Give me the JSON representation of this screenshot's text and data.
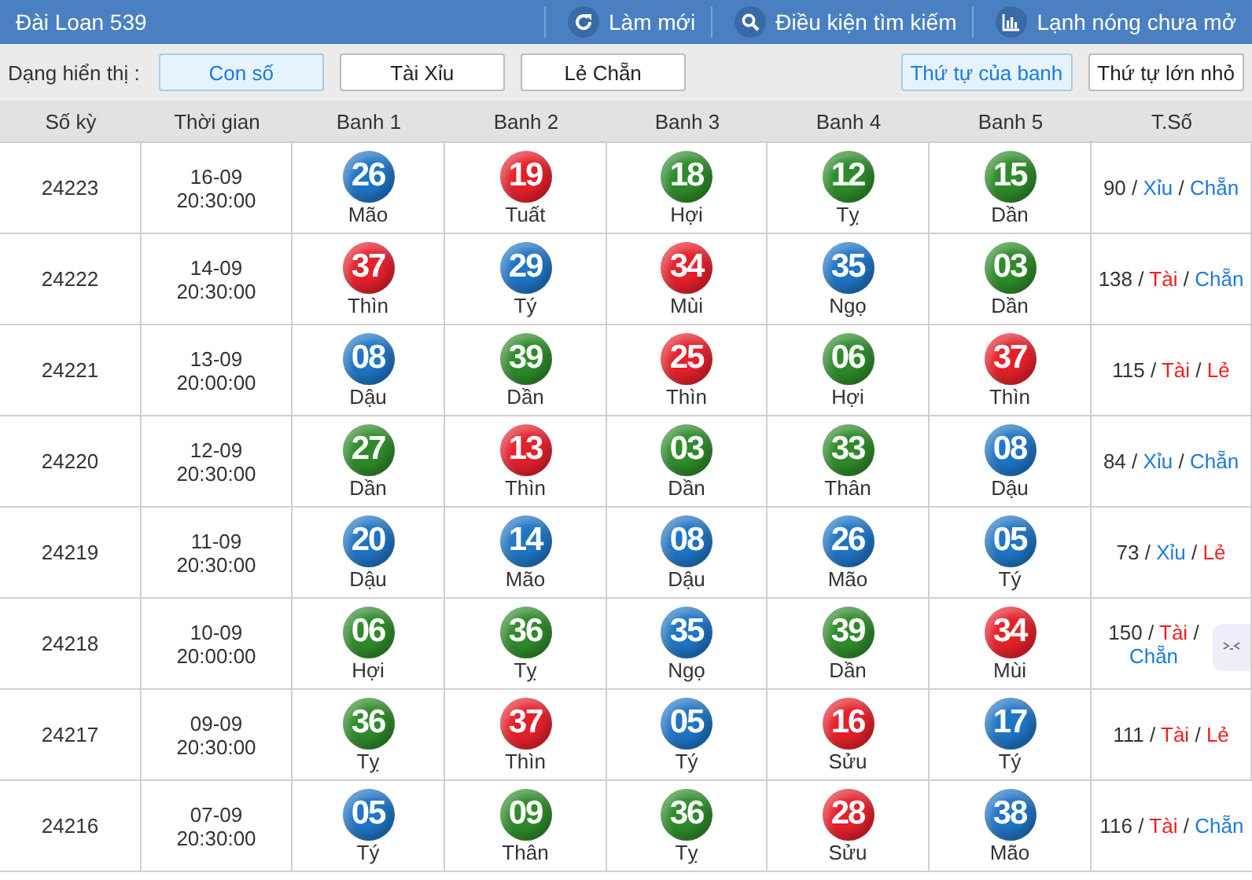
{
  "header": {
    "title": "Đài Loan 539",
    "actions": [
      {
        "label": "Làm mới"
      },
      {
        "label": "Điều kiện tìm kiếm"
      },
      {
        "label": "Lạnh nóng chưa mở"
      }
    ]
  },
  "toolbar": {
    "label": "Dạng hiển thị :",
    "modes": [
      {
        "label": "Con số",
        "selected": true
      },
      {
        "label": "Tài Xỉu",
        "selected": false
      },
      {
        "label": "Lẻ Chẵn",
        "selected": false
      }
    ],
    "orders": [
      {
        "label": "Thứ tự của banh",
        "selected": true
      },
      {
        "label": "Thứ tự lớn nhỏ",
        "selected": false
      }
    ]
  },
  "table": {
    "columns": [
      "Số kỳ",
      "Thời gian",
      "Banh 1",
      "Banh 2",
      "Banh 3",
      "Banh 4",
      "Banh 5",
      "T.Số"
    ],
    "rows": [
      {
        "draw": "24223",
        "date": "16-09",
        "time": "20:30:00",
        "balls": [
          {
            "number": "26",
            "zodiac": "Mão",
            "color": "#1f74c4"
          },
          {
            "number": "19",
            "zodiac": "Tuất",
            "color": "#e5202b"
          },
          {
            "number": "18",
            "zodiac": "Hợi",
            "color": "#2e8a2a"
          },
          {
            "number": "12",
            "zodiac": "Tỵ",
            "color": "#2e8a2a"
          },
          {
            "number": "15",
            "zodiac": "Dần",
            "color": "#2e8a2a"
          }
        ],
        "total": [
          {
            "text": "90"
          },
          {
            "text": "/"
          },
          {
            "text": "Xỉu",
            "color": "#1a7ae0"
          },
          {
            "text": "/"
          },
          {
            "text": "Chẵn",
            "color": "#1a7ae0"
          }
        ]
      },
      {
        "draw": "24222",
        "date": "14-09",
        "time": "20:30:00",
        "balls": [
          {
            "number": "37",
            "zodiac": "Thìn",
            "color": "#e5202b"
          },
          {
            "number": "29",
            "zodiac": "Tý",
            "color": "#1f74c4"
          },
          {
            "number": "34",
            "zodiac": "Mùi",
            "color": "#e5202b"
          },
          {
            "number": "35",
            "zodiac": "Ngọ",
            "color": "#1f74c4"
          },
          {
            "number": "03",
            "zodiac": "Dần",
            "color": "#2e8a2a"
          }
        ],
        "total": [
          {
            "text": "138"
          },
          {
            "text": "/"
          },
          {
            "text": "Tài",
            "color": "#f01e1e"
          },
          {
            "text": "/"
          },
          {
            "text": "Chẵn",
            "color": "#1a7ae0"
          }
        ]
      },
      {
        "draw": "24221",
        "date": "13-09",
        "time": "20:00:00",
        "balls": [
          {
            "number": "08",
            "zodiac": "Dậu",
            "color": "#1f74c4"
          },
          {
            "number": "39",
            "zodiac": "Dần",
            "color": "#2e8a2a"
          },
          {
            "number": "25",
            "zodiac": "Thìn",
            "color": "#e5202b"
          },
          {
            "number": "06",
            "zodiac": "Hợi",
            "color": "#2e8a2a"
          },
          {
            "number": "37",
            "zodiac": "Thìn",
            "color": "#e5202b"
          }
        ],
        "total": [
          {
            "text": "115"
          },
          {
            "text": "/"
          },
          {
            "text": "Tài",
            "color": "#f01e1e"
          },
          {
            "text": "/"
          },
          {
            "text": "Lẻ",
            "color": "#f01e1e"
          }
        ]
      },
      {
        "draw": "24220",
        "date": "12-09",
        "time": "20:30:00",
        "balls": [
          {
            "number": "27",
            "zodiac": "Dần",
            "color": "#2e8a2a"
          },
          {
            "number": "13",
            "zodiac": "Thìn",
            "color": "#e5202b"
          },
          {
            "number": "03",
            "zodiac": "Dần",
            "color": "#2e8a2a"
          },
          {
            "number": "33",
            "zodiac": "Thân",
            "color": "#2e8a2a"
          },
          {
            "number": "08",
            "zodiac": "Dậu",
            "color": "#1f74c4"
          }
        ],
        "total": [
          {
            "text": "84"
          },
          {
            "text": "/"
          },
          {
            "text": "Xỉu",
            "color": "#1a7ae0"
          },
          {
            "text": "/"
          },
          {
            "text": "Chẵn",
            "color": "#1a7ae0"
          }
        ]
      },
      {
        "draw": "24219",
        "date": "11-09",
        "time": "20:30:00",
        "balls": [
          {
            "number": "20",
            "zodiac": "Dậu",
            "color": "#1f74c4"
          },
          {
            "number": "14",
            "zodiac": "Mão",
            "color": "#1f74c4"
          },
          {
            "number": "08",
            "zodiac": "Dậu",
            "color": "#1f74c4"
          },
          {
            "number": "26",
            "zodiac": "Mão",
            "color": "#1f74c4"
          },
          {
            "number": "05",
            "zodiac": "Tý",
            "color": "#1f74c4"
          }
        ],
        "total": [
          {
            "text": "73"
          },
          {
            "text": "/"
          },
          {
            "text": "Xỉu",
            "color": "#1a7ae0"
          },
          {
            "text": "/"
          },
          {
            "text": "Lẻ",
            "color": "#f01e1e"
          }
        ]
      },
      {
        "draw": "24218",
        "date": "10-09",
        "time": "20:00:00",
        "balls": [
          {
            "number": "06",
            "zodiac": "Hợi",
            "color": "#2e8a2a"
          },
          {
            "number": "36",
            "zodiac": "Tỵ",
            "color": "#2e8a2a"
          },
          {
            "number": "35",
            "zodiac": "Ngọ",
            "color": "#1f74c4"
          },
          {
            "number": "39",
            "zodiac": "Dần",
            "color": "#2e8a2a"
          },
          {
            "number": "34",
            "zodiac": "Mùi",
            "color": "#e5202b"
          }
        ],
        "total": [
          {
            "text": "150"
          },
          {
            "text": "/"
          },
          {
            "text": "Tài",
            "color": "#f01e1e"
          },
          {
            "text": "/"
          },
          {
            "text": "Chẵn",
            "color": "#1a7ae0"
          }
        ]
      },
      {
        "draw": "24217",
        "date": "09-09",
        "time": "20:30:00",
        "balls": [
          {
            "number": "36",
            "zodiac": "Tỵ",
            "color": "#2e8a2a"
          },
          {
            "number": "37",
            "zodiac": "Thìn",
            "color": "#e5202b"
          },
          {
            "number": "05",
            "zodiac": "Tý",
            "color": "#1f74c4"
          },
          {
            "number": "16",
            "zodiac": "Sửu",
            "color": "#e5202b"
          },
          {
            "number": "17",
            "zodiac": "Tý",
            "color": "#1f74c4"
          }
        ],
        "total": [
          {
            "text": "111"
          },
          {
            "text": "/"
          },
          {
            "text": "Tài",
            "color": "#f01e1e"
          },
          {
            "text": "/"
          },
          {
            "text": "Lẻ",
            "color": "#f01e1e"
          }
        ]
      },
      {
        "draw": "24216",
        "date": "07-09",
        "time": "20:30:00",
        "balls": [
          {
            "number": "05",
            "zodiac": "Tý",
            "color": "#1f74c4"
          },
          {
            "number": "09",
            "zodiac": "Thân",
            "color": "#2e8a2a"
          },
          {
            "number": "36",
            "zodiac": "Tỵ",
            "color": "#2e8a2a"
          },
          {
            "number": "28",
            "zodiac": "Sửu",
            "color": "#e5202b"
          },
          {
            "number": "38",
            "zodiac": "Mão",
            "color": "#1f74c4"
          }
        ],
        "total": [
          {
            "text": "116"
          },
          {
            "text": "/"
          },
          {
            "text": "Tài",
            "color": "#f01e1e"
          },
          {
            "text": "/"
          },
          {
            "text": "Chẵn",
            "color": "#1a7ae0"
          }
        ]
      }
    ]
  }
}
